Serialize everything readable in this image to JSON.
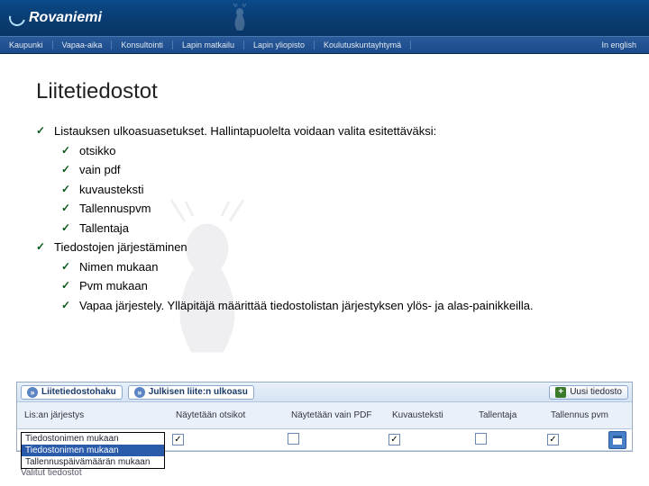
{
  "header": {
    "logo_text": "Rovaniemi"
  },
  "nav": {
    "items": [
      "Kaupunki",
      "Vapaa-aika",
      "Konsultointi",
      "Lapin matkailu",
      "Lapin yliopisto",
      "Koulutuskuntayhtymä"
    ],
    "english": "In english"
  },
  "page": {
    "title": "Liitetiedostot"
  },
  "content": {
    "top1": "Listauksen ulkoasuasetukset. Hallintapuolelta voidaan valita esitettäväksi:",
    "top1_items": [
      "otsikko",
      "vain pdf",
      "kuvausteksti",
      "Tallennuspvm",
      "Tallentaja"
    ],
    "top2": "Tiedostojen järjestäminen",
    "top2_items": [
      "Nimen mukaan",
      "Pvm mukaan",
      "Vapaa järjestely. Ylläpitäjä määrittää tiedostolistan järjestyksen ylös- ja alas-painikkeilla."
    ]
  },
  "admin": {
    "toggle1": "Liitetiedostohaku",
    "toggle2": "Julkisen liite:n ulkoasu",
    "new_btn": "Uusi tiedosto",
    "cols": [
      "Lis:an järjestys",
      "Näytetään otsikot",
      "Näytetään vain PDF",
      "Kuvausteksti",
      "Tallentaja",
      "Tallennus pvm"
    ],
    "select_value": "Tiedostonimen mukaan",
    "dropdown": [
      "Tiedostonimen mukaan",
      "Tiedostonimen mukaan",
      "Tallennuspäivämäärän mukaan"
    ],
    "valitut": "Valitut tiedostot"
  },
  "glyphs": {
    "check": "✓",
    "chev": "»",
    "down": "▾",
    "plus": "+"
  }
}
